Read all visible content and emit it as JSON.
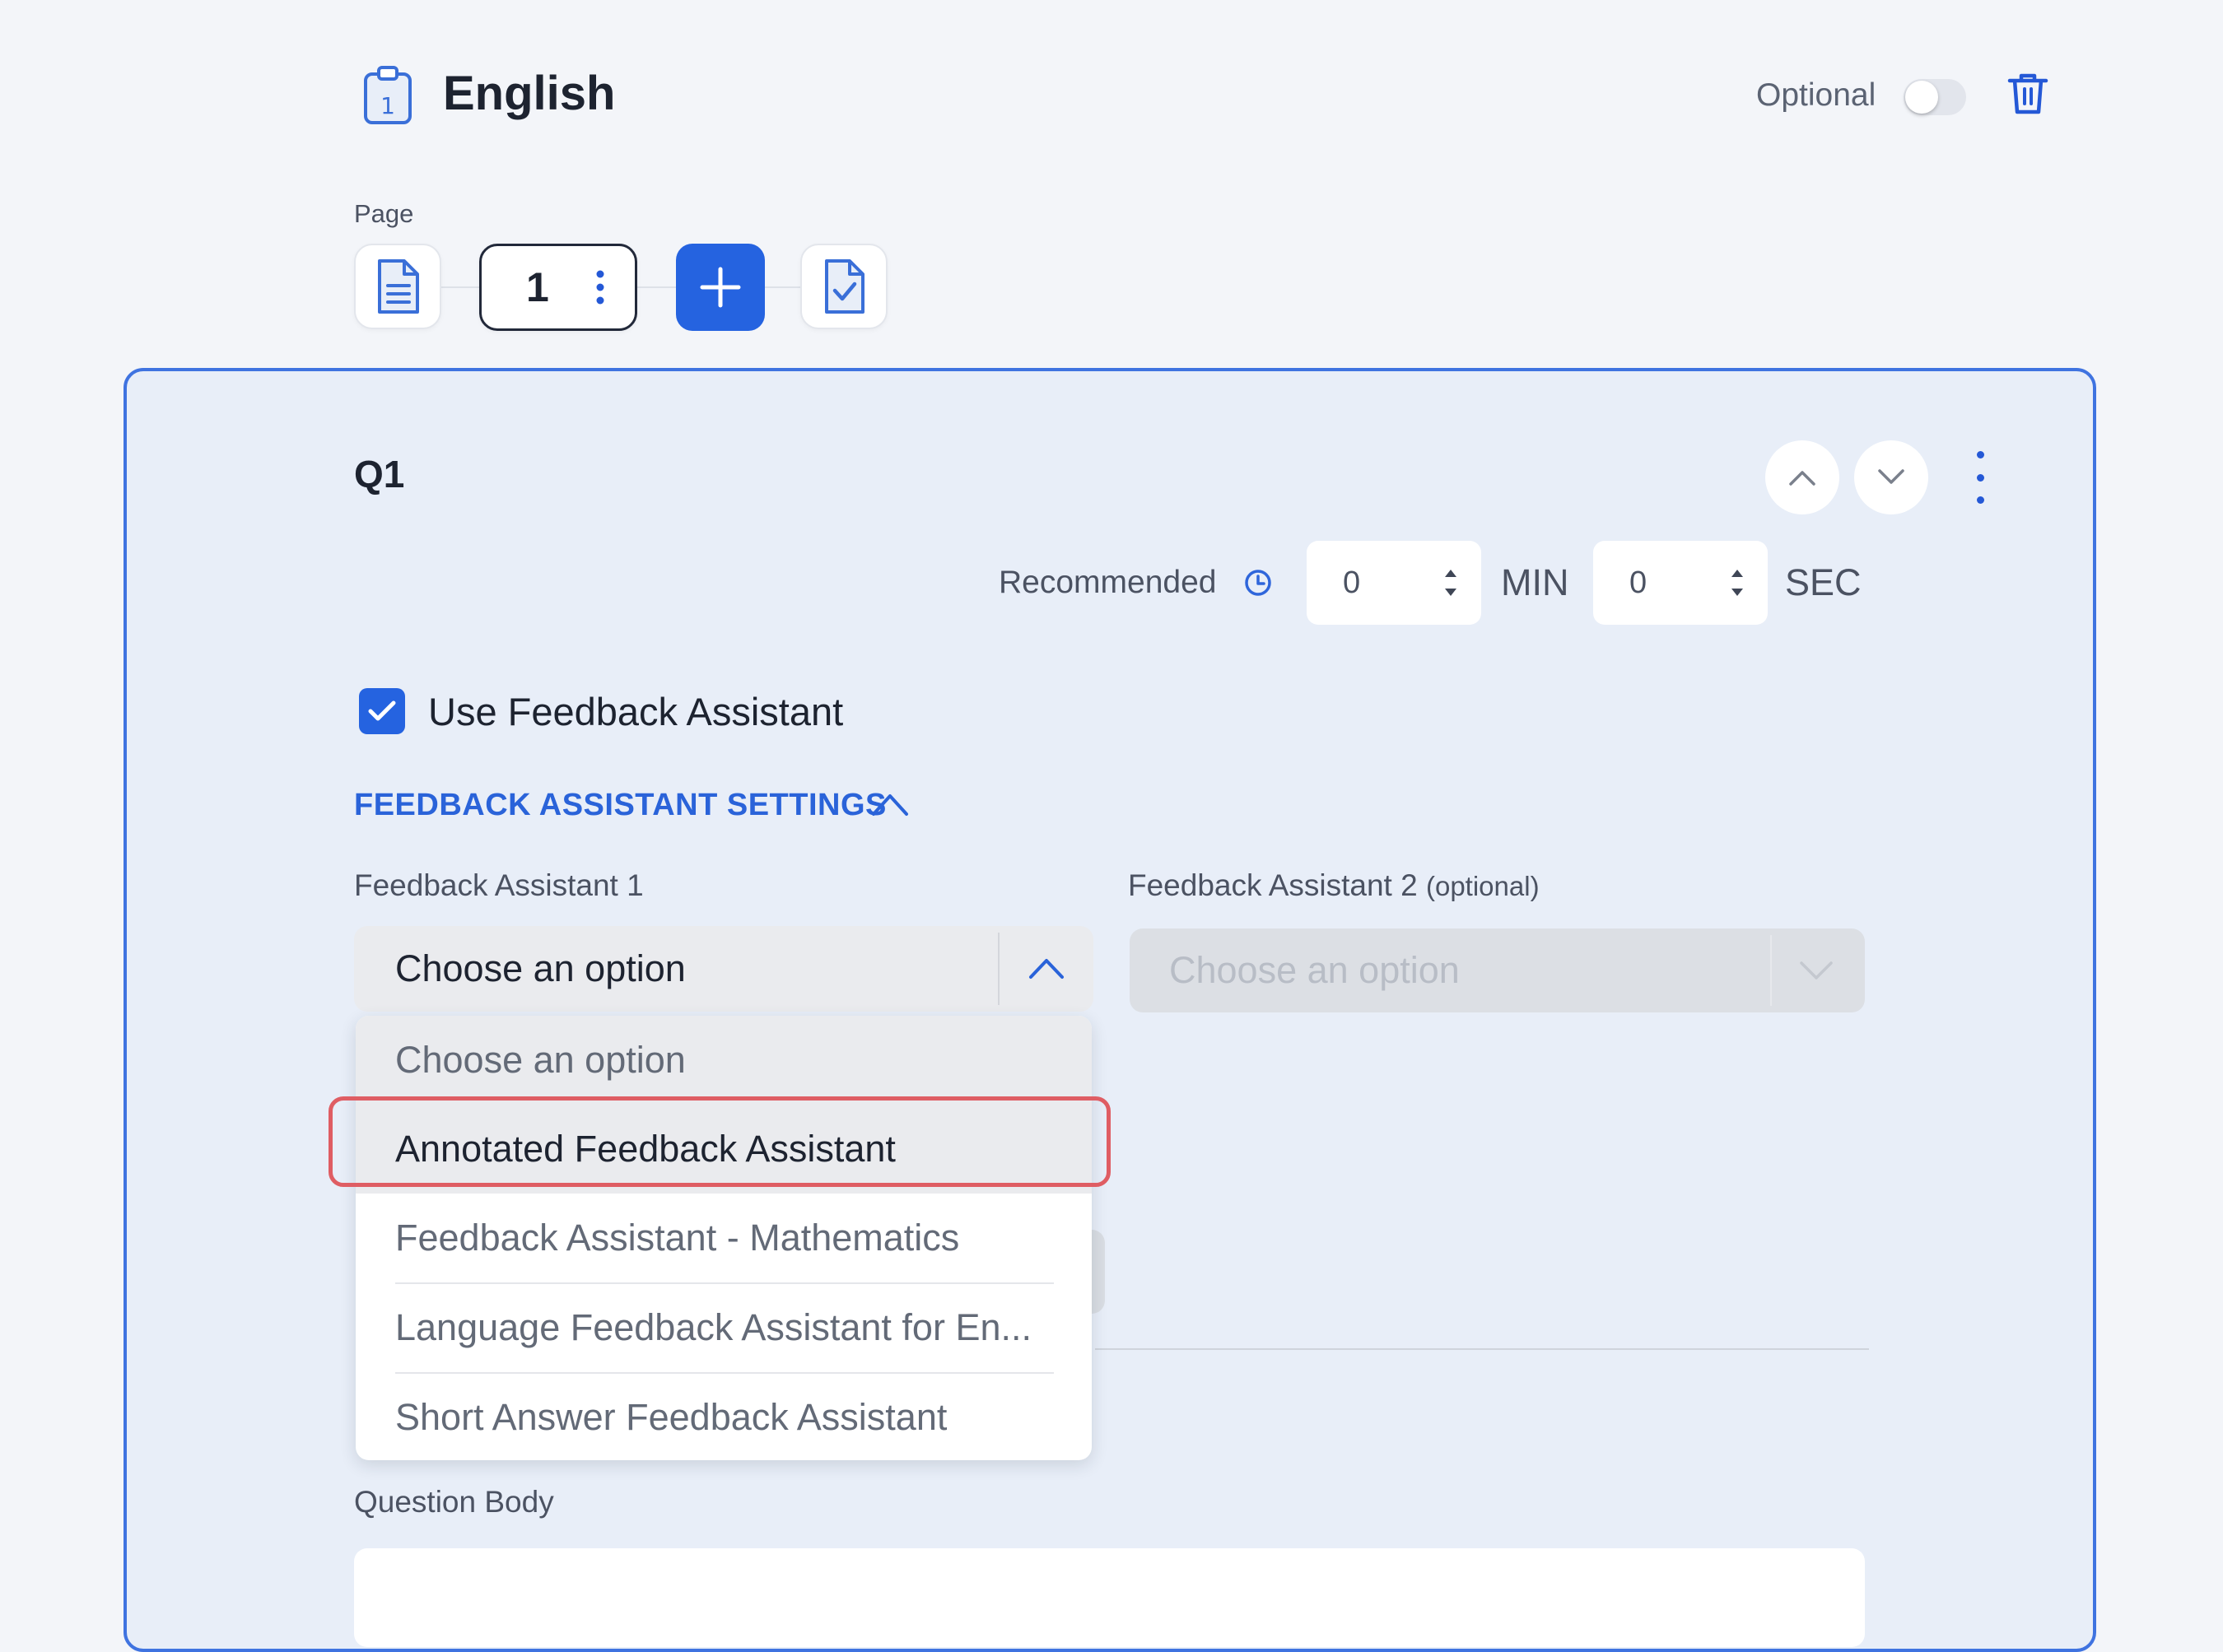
{
  "header": {
    "title": "English",
    "title_icon": "clipboard-number-icon",
    "optional_label": "Optional",
    "optional_enabled": false,
    "delete_icon": "trash-icon"
  },
  "pages": {
    "label": "Page",
    "current_page": "1",
    "buttons": [
      "document-icon",
      "page-1",
      "plus-icon",
      "clipboard-check-icon"
    ]
  },
  "question": {
    "label": "Q1",
    "recommended_label": "Recommended",
    "minutes": "0",
    "min_unit": "MIN",
    "seconds": "0",
    "sec_unit": "SEC",
    "use_feedback_assistant": {
      "label": "Use Feedback Assistant",
      "checked": true
    },
    "settings_toggle": "FEEDBACK ASSISTANT SETTINGS",
    "fa1": {
      "label": "Feedback Assistant 1",
      "value": "Choose an option",
      "options": [
        "Choose an option",
        "Annotated Feedback Assistant",
        "Feedback Assistant - Mathematics",
        "Language Feedback Assistant for En...",
        "Short Answer Feedback Assistant"
      ],
      "highlighted_index": 1
    },
    "fa2": {
      "label": "Feedback Assistant 2",
      "label_suffix": "(optional)",
      "placeholder": "Choose an option",
      "disabled": true
    },
    "body_label": "Question Body"
  },
  "colors": {
    "accent": "#2563e0",
    "card_border": "#3f73e0",
    "card_bg": "#e8eef8",
    "highlight_border": "#df5d63"
  }
}
